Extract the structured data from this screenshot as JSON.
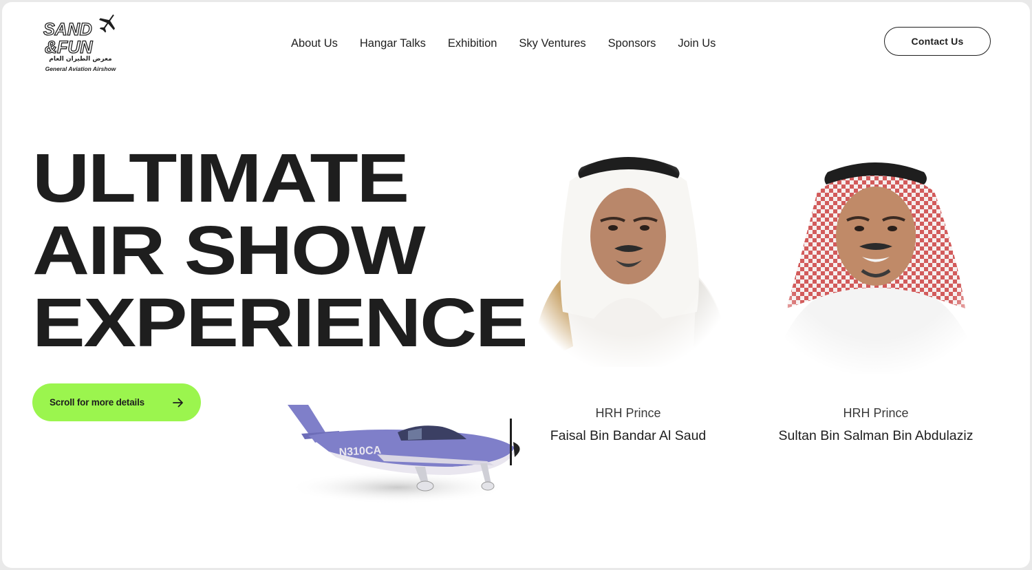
{
  "header": {
    "logo": {
      "wordmark": "SAND & FUN",
      "arabic_text": "معرض الطيران العام",
      "english_text": "General Aviation Airshow"
    },
    "nav": [
      {
        "label": "About Us"
      },
      {
        "label": "Hangar Talks"
      },
      {
        "label": "Exhibition"
      },
      {
        "label": "Sky Ventures"
      },
      {
        "label": "Sponsors"
      },
      {
        "label": "Join Us"
      }
    ],
    "contact_label": "Contact Us"
  },
  "hero": {
    "title_lines": [
      "ULTIMATE",
      "AIR SHOW",
      "EXPERIENCE"
    ],
    "scroll_label": "Scroll for more details",
    "plane_registration": "N310CA"
  },
  "people": [
    {
      "title": "HRH Prince",
      "name": "Faisal Bin Bandar Al Saud"
    },
    {
      "title": "HRH Prince",
      "name": "Sultan Bin Salman Bin Abdulaziz"
    }
  ],
  "colors": {
    "accent_green": "#9bf54e",
    "text_dark": "#1e1e1e",
    "plane_purple": "#7f7fc9"
  },
  "icons": {
    "scroll_arrow": "arrow-right-icon",
    "logo_plane": "airplane-icon"
  }
}
